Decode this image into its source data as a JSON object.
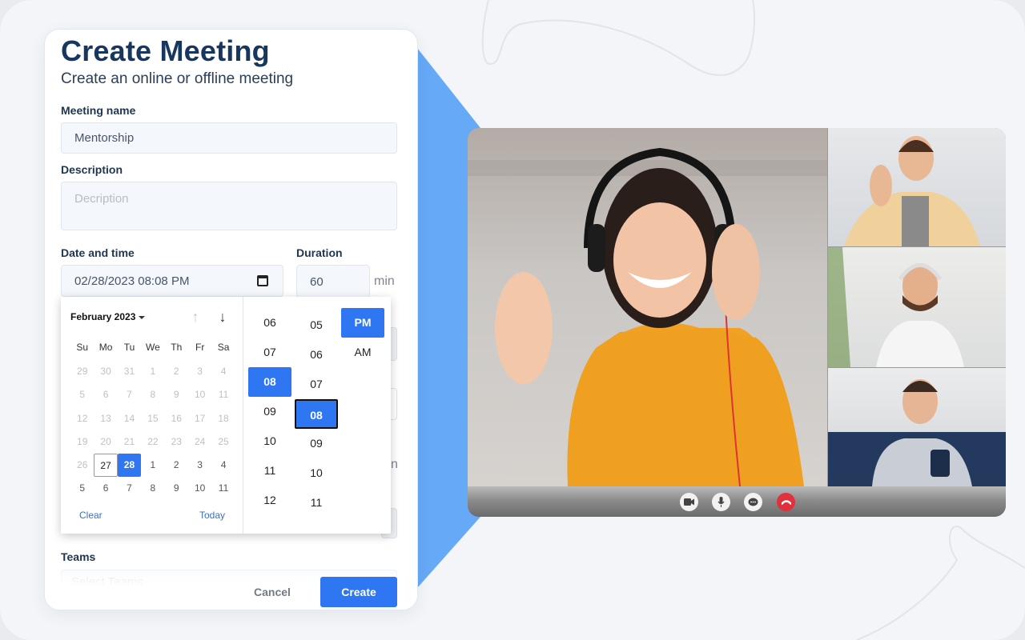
{
  "form": {
    "title": "Create Meeting",
    "subtitle": "Create an online or offline meeting",
    "meeting_name": {
      "label": "Meeting name",
      "value": "Mentorship"
    },
    "description": {
      "label": "Description",
      "placeholder": "Decription"
    },
    "date_time": {
      "label": "Date and time",
      "value": "02/28/2023 08:08 PM",
      "icon": "calendar-icon"
    },
    "duration": {
      "label": "Duration",
      "value": "60",
      "unit": "min"
    },
    "hidden_label_fragment": "n",
    "teams": {
      "label": "Teams",
      "placeholder": "Select Teams"
    },
    "cancel_label": "Cancel",
    "create_label": "Create"
  },
  "picker": {
    "month_label": "February 2023",
    "prev_icon": "arrow-up-icon",
    "next_icon": "arrow-down-icon",
    "weekdays": [
      "Su",
      "Mo",
      "Tu",
      "We",
      "Th",
      "Fr",
      "Sa"
    ],
    "days": [
      {
        "d": "29",
        "s": "muted"
      },
      {
        "d": "30",
        "s": "muted"
      },
      {
        "d": "31",
        "s": "muted"
      },
      {
        "d": "1",
        "s": "muted"
      },
      {
        "d": "2",
        "s": "muted"
      },
      {
        "d": "3",
        "s": "muted"
      },
      {
        "d": "4",
        "s": "muted"
      },
      {
        "d": "5",
        "s": "muted"
      },
      {
        "d": "6",
        "s": "muted"
      },
      {
        "d": "7",
        "s": "muted"
      },
      {
        "d": "8",
        "s": "muted"
      },
      {
        "d": "9",
        "s": "muted"
      },
      {
        "d": "10",
        "s": "muted"
      },
      {
        "d": "11",
        "s": "muted"
      },
      {
        "d": "12",
        "s": "muted"
      },
      {
        "d": "13",
        "s": "muted"
      },
      {
        "d": "14",
        "s": "muted"
      },
      {
        "d": "15",
        "s": "muted"
      },
      {
        "d": "16",
        "s": "muted"
      },
      {
        "d": "17",
        "s": "muted"
      },
      {
        "d": "18",
        "s": "muted"
      },
      {
        "d": "19",
        "s": "muted"
      },
      {
        "d": "20",
        "s": "muted"
      },
      {
        "d": "21",
        "s": "muted"
      },
      {
        "d": "22",
        "s": "muted"
      },
      {
        "d": "23",
        "s": "muted"
      },
      {
        "d": "24",
        "s": "muted"
      },
      {
        "d": "25",
        "s": "muted"
      },
      {
        "d": "26",
        "s": "muted"
      },
      {
        "d": "27",
        "s": "today"
      },
      {
        "d": "28",
        "s": "selected"
      },
      {
        "d": "1",
        "s": "cur"
      },
      {
        "d": "2",
        "s": "cur"
      },
      {
        "d": "3",
        "s": "cur"
      },
      {
        "d": "4",
        "s": "cur"
      },
      {
        "d": "5",
        "s": "cur"
      },
      {
        "d": "6",
        "s": "cur"
      },
      {
        "d": "7",
        "s": "cur"
      },
      {
        "d": "8",
        "s": "cur"
      },
      {
        "d": "9",
        "s": "cur"
      },
      {
        "d": "10",
        "s": "cur"
      },
      {
        "d": "11",
        "s": "cur"
      }
    ],
    "clear_label": "Clear",
    "today_label": "Today",
    "hours": [
      "06",
      "07",
      "08",
      "09",
      "10",
      "11",
      "12"
    ],
    "selected_hour": "08",
    "minutes": [
      "05",
      "06",
      "07",
      "08",
      "09",
      "10",
      "11"
    ],
    "selected_minute": "08",
    "meridiem": [
      "PM",
      "AM"
    ],
    "selected_meridiem": "PM"
  },
  "video_call": {
    "participants": [
      {
        "role": "main",
        "desc": "woman in yellow shirt with headset waving"
      },
      {
        "role": "tile",
        "desc": "man in beige shirt with headset waving"
      },
      {
        "role": "tile",
        "desc": "man in white shirt with headphones"
      },
      {
        "role": "tile",
        "desc": "man in plaid shirt holding phone"
      }
    ],
    "controls": [
      {
        "name": "camera",
        "icon": "video-camera-icon"
      },
      {
        "name": "microphone",
        "icon": "microphone-icon"
      },
      {
        "name": "chat",
        "icon": "chat-icon"
      },
      {
        "name": "end-call",
        "icon": "phone-hangup-icon"
      }
    ]
  },
  "colors": {
    "accent": "#2f77f2",
    "title": "#17375e",
    "wedge": "#65a9f7",
    "end_call": "#e0313c"
  }
}
